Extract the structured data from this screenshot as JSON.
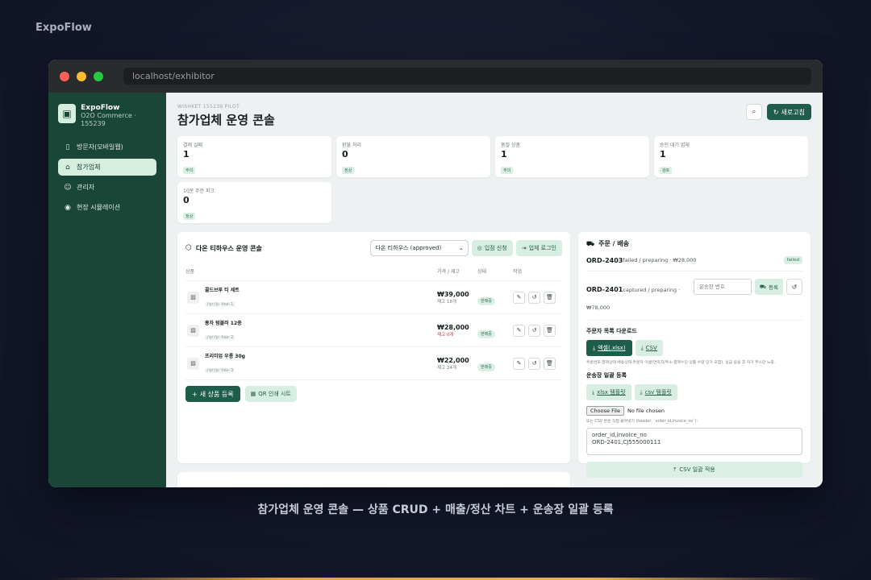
{
  "brand": "ExpoFlow",
  "caption": "참가업체 운영 콘솔 — 상품 CRUD + 매출/정산 차트 + 운송장 일괄 등록",
  "window": {
    "url": "localhost/exhibitor"
  },
  "sidebar": {
    "title": "ExpoFlow",
    "subtitle": "O2O Commerce · 155239",
    "items": [
      {
        "label": "방문자(모바일웹)",
        "icon": "phone-icon"
      },
      {
        "label": "참가업체",
        "icon": "store-icon",
        "active": true
      },
      {
        "label": "관리자",
        "icon": "users-icon"
      },
      {
        "label": "현장 시뮬레이션",
        "icon": "pin-icon"
      }
    ]
  },
  "header": {
    "pilot": "WISHKET 155239 PILOT",
    "title": "참가업체 운영 콘솔",
    "refresh_label": "새로고침"
  },
  "kpis": [
    {
      "label": "결제 실패",
      "value": "1",
      "badge": "주의"
    },
    {
      "label": "환불 처리",
      "value": "0",
      "badge": "정상"
    },
    {
      "label": "품절 상품",
      "value": "1",
      "badge": "주의"
    },
    {
      "label": "승인 대기 업체",
      "value": "1",
      "badge": "검토"
    },
    {
      "label": "10분 주문 피크",
      "value": "0",
      "badge": "정상"
    }
  ],
  "products_panel": {
    "title": "다온 티하우스 운영 콘솔",
    "select_value": "다온 티하우스 (approved)",
    "apply_label": "입점 신청",
    "login_label": "업체 로그인",
    "columns": [
      "상품",
      "가격 / 재고",
      "상태",
      "작업"
    ],
    "rows": [
      {
        "name": "콜드브루 티 세트",
        "slug": "/qr/p-tea-1",
        "price": "₩39,000",
        "stock": "재고 18개",
        "low": false,
        "status": "판매중"
      },
      {
        "name": "홍차 텀블러 12종",
        "slug": "/qr/p-tea-2",
        "price": "₩28,000",
        "stock": "재고 0개",
        "low": true,
        "status": "판매중"
      },
      {
        "name": "프리미엄 우롱 30g",
        "slug": "/qr/p-tea-3",
        "price": "₩22,000",
        "stock": "재고 24개",
        "low": false,
        "status": "판매중"
      }
    ],
    "new_product_label": "새 상품 등록",
    "qr_label": "QR 인쇄 시트"
  },
  "orders_panel": {
    "title": "주문 / 배송",
    "order1": {
      "id": "ORD-2403",
      "meta": "failed / preparing · ₩28,000",
      "badge": "failed"
    },
    "order2": {
      "id": "ORD-2401",
      "meta": "captured / preparing · ₩78,000",
      "invoice_placeholder": "운송장 번호",
      "register_label": "등록"
    },
    "download_title": "주문자 목록 다운로드",
    "excel_label": "엑셀(.xlsx)",
    "csv_label": "CSV",
    "download_note": "주문번호·결제상태·배송상태·주문자 이름(연락처/주소·결제수단·상품·수량 단가 포함). 실금 응용 후 자가 부스만 노출.",
    "bulk_title": "운송장 일괄 등록",
    "xlsx_template_label": "xlsx 템플릿",
    "csv_template_label": "csv 템플릿",
    "file_button": "Choose File",
    "file_status": "No file chosen",
    "paste_note": "또는 CSV 본문 직접 붙여넣기 (header: `order_id,invoice_no`):",
    "textarea": "order_id,invoice_no\nORD-2401,CJ555000111",
    "apply_label": "CSV 일괄 적용"
  }
}
